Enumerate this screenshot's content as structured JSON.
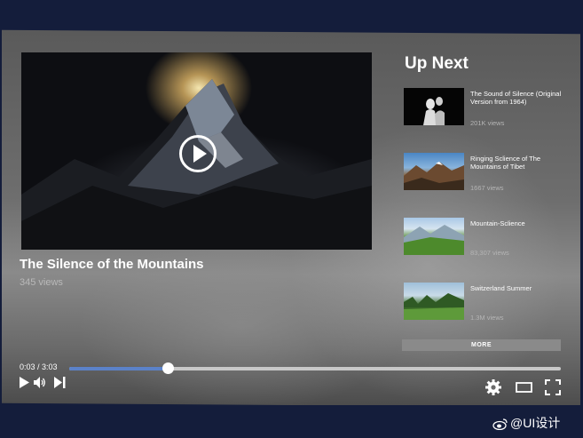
{
  "player": {
    "title": "The Silence of the Mountains",
    "views": "345 views",
    "time": "0:03 / 3:03",
    "progress": 0.2
  },
  "upnext": {
    "heading": "Up Next",
    "items": [
      {
        "title": "The Sound of Silence (Original Version from 1964)",
        "views": "201K views"
      },
      {
        "title": "Ringing Sclience of The Mountains of Tibet",
        "views": "1667 views"
      },
      {
        "title": "Mountain-Sclience",
        "views": "83,307 views"
      },
      {
        "title": "Switzerland Summer",
        "views": "1.3M views"
      }
    ],
    "more_label": "MORE"
  },
  "watermark": "@UI设计",
  "icons": {
    "play": "play-icon",
    "volume": "volume-icon",
    "next": "skip-next-icon",
    "settings": "gear-icon",
    "theater": "theater-mode-icon",
    "fullscreen": "fullscreen-icon"
  },
  "colors": {
    "accent": "#5b82c9",
    "frame": "#141d3b"
  }
}
